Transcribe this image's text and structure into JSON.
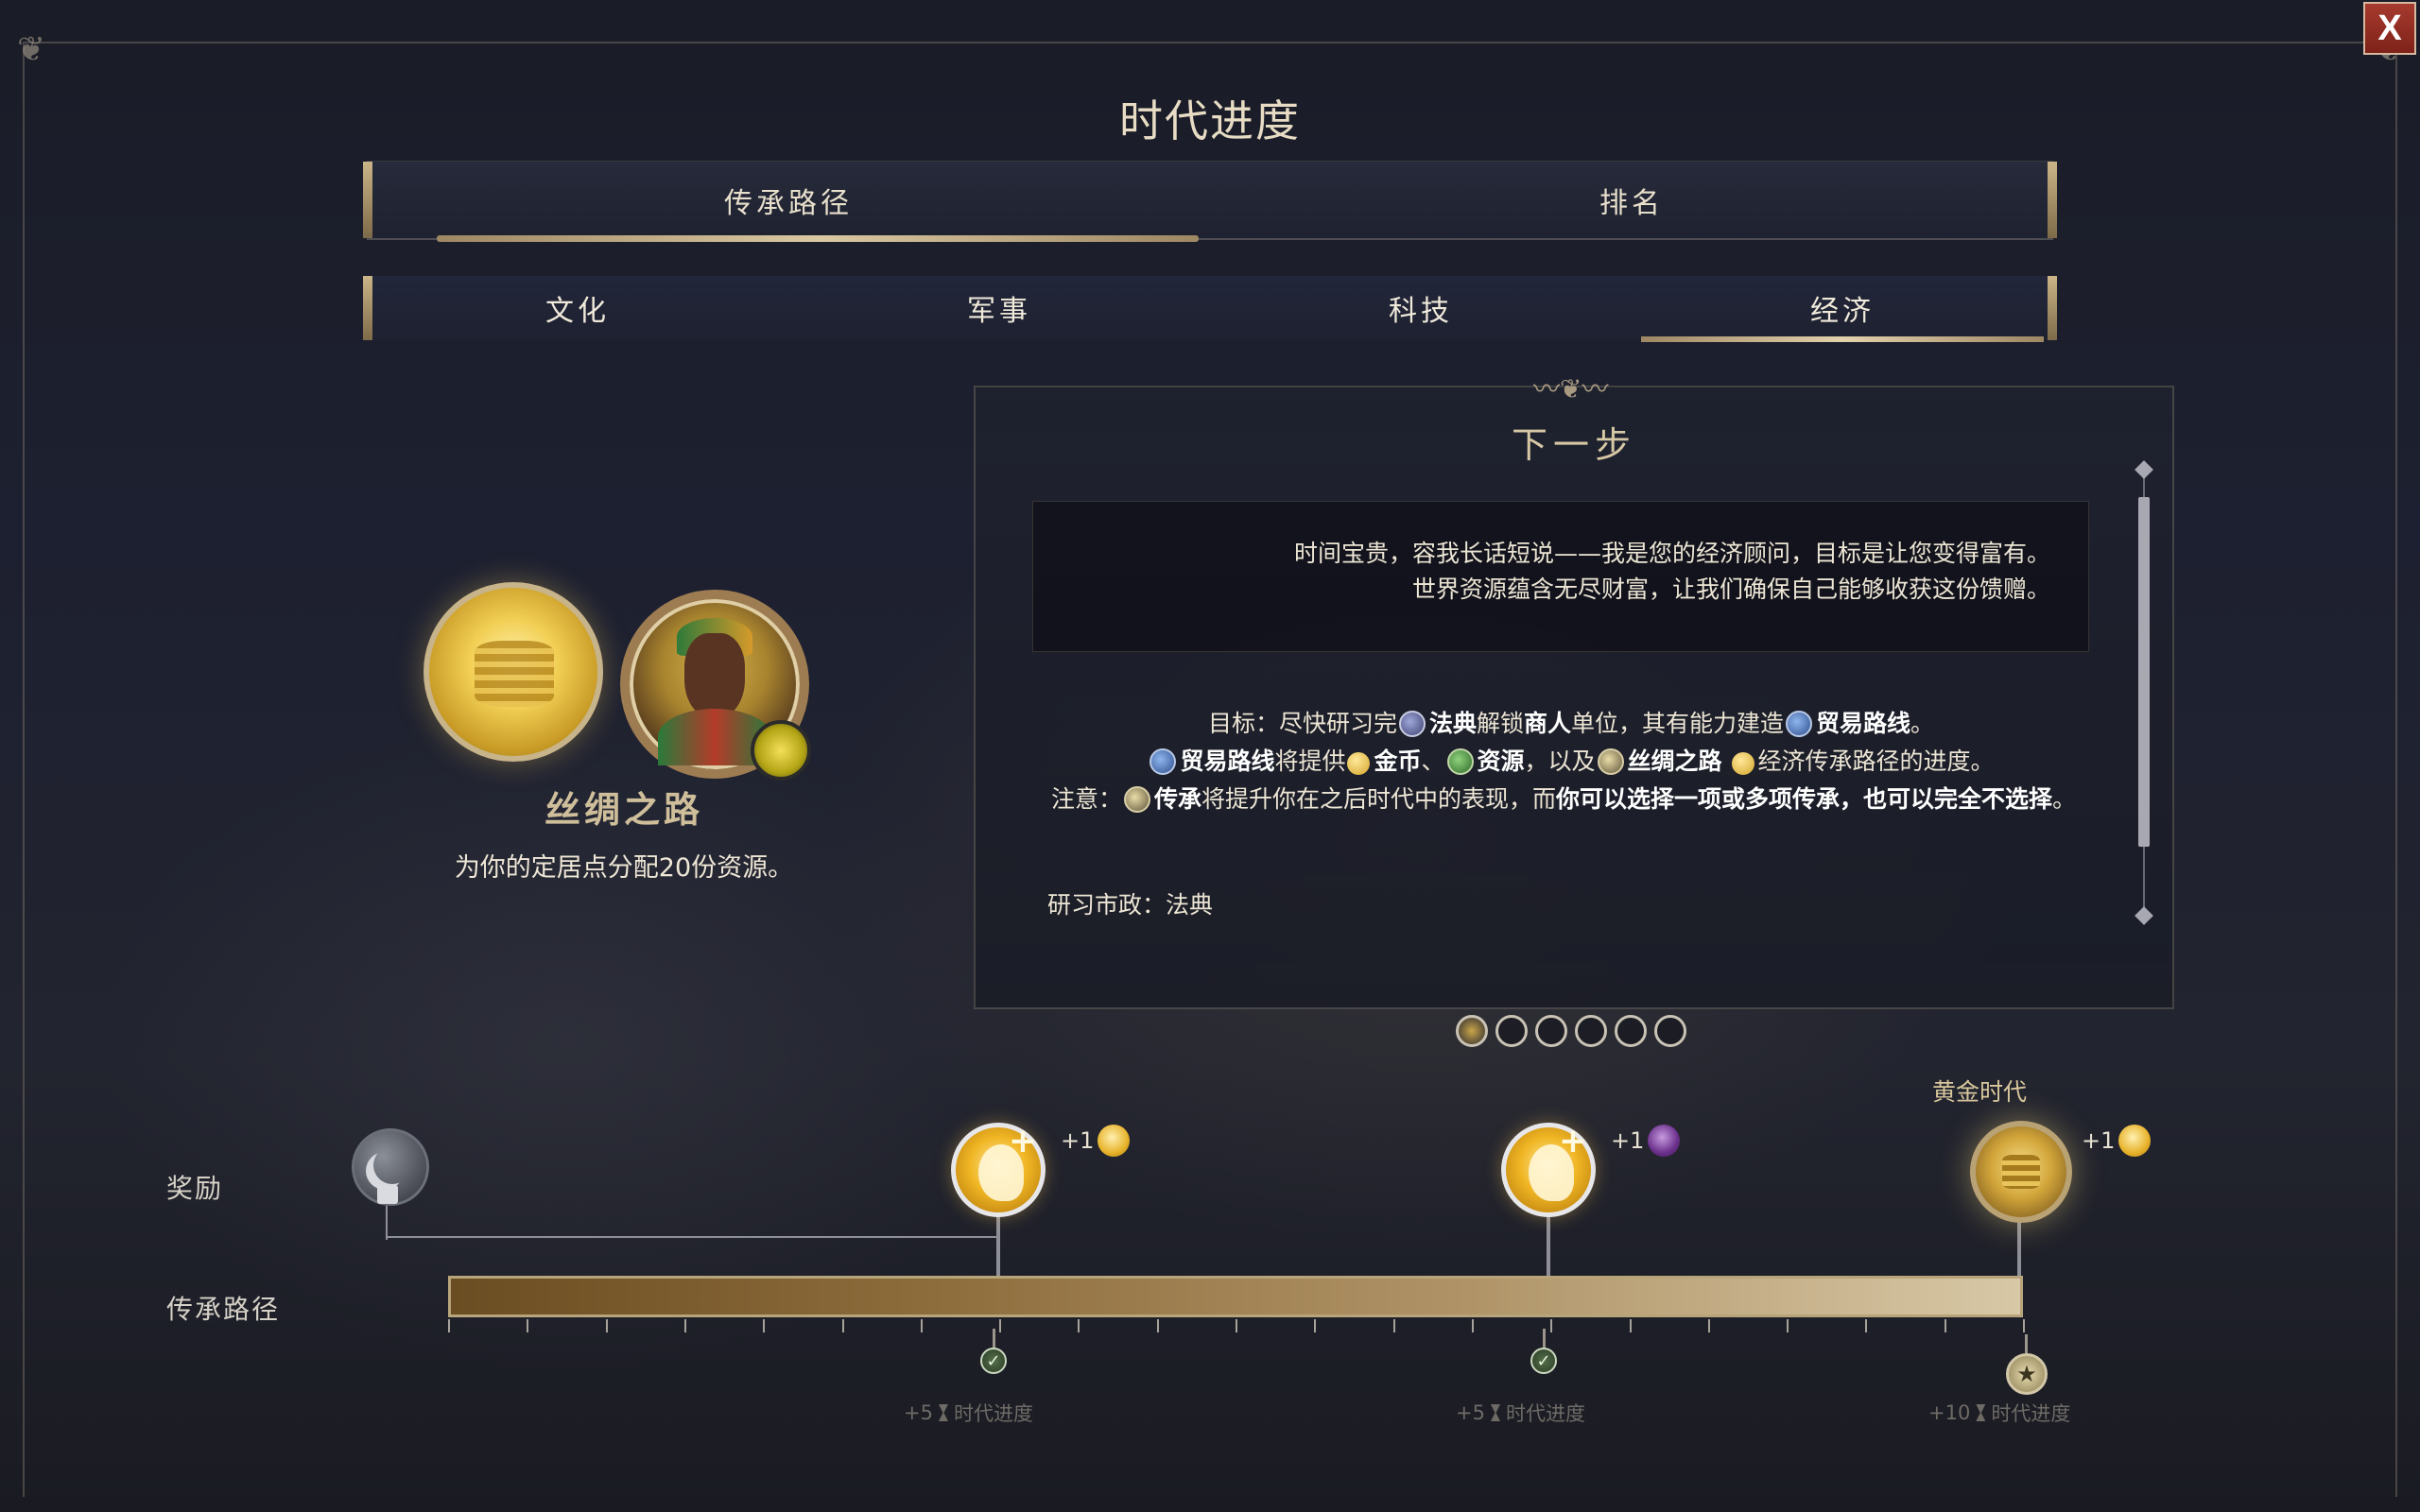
{
  "window": {
    "title": "时代进度",
    "close_label": "X"
  },
  "tabs": [
    {
      "label": "传承路径",
      "active": true
    },
    {
      "label": "排名",
      "active": false
    }
  ],
  "subtabs": [
    {
      "label": "文化",
      "active": false
    },
    {
      "label": "军事",
      "active": false
    },
    {
      "label": "科技",
      "active": false
    },
    {
      "label": "经济",
      "active": true
    }
  ],
  "legacy": {
    "name": "丝绸之路",
    "description": "为你的定居点分配20份资源。",
    "icon": "gold-coin-laurel-icon",
    "leader_portrait": "leader-portrait"
  },
  "next_step": {
    "title": "下一步",
    "quote_line1": "时间宝贵，容我长话短说——我是您的经济顾问，目标是让您变得富有。",
    "quote_line2": "世界资源蕴含无尽财富，让我们确保自己能够收获这份馈赠。",
    "objective": {
      "l1_a": "目标：尽快研习完",
      "l1_b": "法典",
      "l1_c": "解锁",
      "l1_d": "商人",
      "l1_e": "单位，其有能力建造",
      "l1_f": "贸易路线",
      "l1_g": "。",
      "l2_a": "贸易路线",
      "l2_b": "将提供",
      "l2_c": "金币",
      "l2_d": "、",
      "l2_e": "资源",
      "l2_f": "，以及",
      "l2_g": "丝绸之路",
      "l2_h": "经济传承路径的进度。",
      "l3_a": "注意：",
      "l3_b": "传承",
      "l3_c": "将提升你在之后时代中的表现，而",
      "l3_d": "你可以选择一项或多项传承，也可以完全不选择",
      "l3_e": "。"
    },
    "civic": "研习市政：法典",
    "pages": 6,
    "current_page": 1
  },
  "timeline": {
    "rewards_label": "奖励",
    "path_label": "传承路径",
    "golden_age_label": "黄金时代",
    "rewards": [
      {
        "bonus": "+1",
        "icon": "great-person-icon"
      },
      {
        "bonus": "+1",
        "icon": "purple-relic-icon"
      },
      {
        "bonus": "+1",
        "icon": "golden-age-icon"
      }
    ],
    "milestones": [
      {
        "label": "+5",
        "suffix": "时代进度"
      },
      {
        "label": "+5",
        "suffix": "时代进度"
      },
      {
        "label": "+10",
        "suffix": "时代进度"
      }
    ],
    "progress_fraction": 1.0
  },
  "colors": {
    "accent_gold": "#d9c8a2",
    "background": "#1d2030",
    "close_red": "#a73a2e"
  }
}
